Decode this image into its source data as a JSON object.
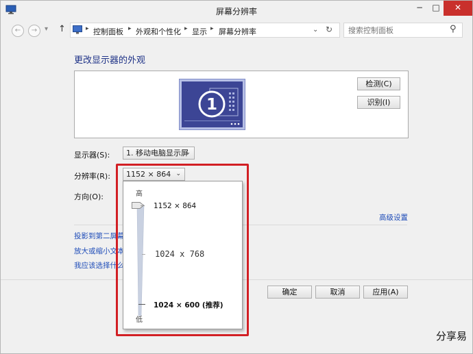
{
  "window": {
    "title": "屏幕分辨率",
    "controls": {
      "minimize": "−",
      "maximize": "□",
      "close": "✕"
    }
  },
  "nav": {
    "back_icon": "←",
    "forward_icon": "→",
    "dropdown_icon": "▾",
    "up_icon": "↑",
    "breadcrumb": [
      "控制面板",
      "外观和个性化",
      "显示",
      "屏幕分辨率"
    ],
    "refresh_icon": "↻"
  },
  "search": {
    "placeholder": "搜索控制面板",
    "icon": "⚲"
  },
  "main": {
    "heading": "更改显示器的外观",
    "detect_button": "检测(C)",
    "identify_button": "识别(I)",
    "monitor_number": "1",
    "display_label": "显示器(S):",
    "display_value": "1. 移动电脑显示屏",
    "resolution_label": "分辨率(R):",
    "resolution_value": "1152 × 864",
    "orientation_label": "方向(O):",
    "advanced_link": "高级设置",
    "links": [
      "投影到第二屏幕",
      "放大或缩小文本",
      "我应该选择什么"
    ]
  },
  "footer": {
    "ok": "确定",
    "cancel": "取消",
    "apply": "应用(A)"
  },
  "popup": {
    "high_label": "高",
    "low_label": "低",
    "options": [
      "1152 × 864",
      "1024  x  768",
      "1024 × 600 (推荐)"
    ],
    "selected_index": 0
  },
  "colors": {
    "accent": "#1e3287",
    "link": "#1e4cb8",
    "highlight": "#d21f24",
    "monitor": "#3c4595"
  },
  "watermark": "分享易"
}
